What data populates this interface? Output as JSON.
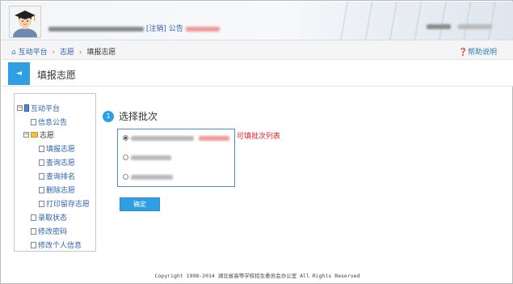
{
  "header": {
    "logout_label": "[注销]",
    "notice_label": "公告",
    "avatar_icon": "graduate-avatar-icon"
  },
  "navbar": {
    "breadcrumb": [
      "互动平台",
      "志愿",
      "填报志愿"
    ],
    "help_label": "帮助说明",
    "home_icon": "home-icon",
    "help_icon": "help-circle-icon"
  },
  "titlebar": {
    "back_label": "◄",
    "title": "填报志愿"
  },
  "sidebar": {
    "root": "互动平台",
    "items": [
      {
        "label": "信息公告",
        "level": 1,
        "type": "doc"
      },
      {
        "label": "志愿",
        "level": 1,
        "type": "folder"
      },
      {
        "label": "填报志愿",
        "level": 2,
        "type": "doc"
      },
      {
        "label": "查询志愿",
        "level": 2,
        "type": "doc"
      },
      {
        "label": "查询排名",
        "level": 2,
        "type": "doc"
      },
      {
        "label": "删除志愿",
        "level": 2,
        "type": "doc"
      },
      {
        "label": "打印留存志愿",
        "level": 2,
        "type": "doc"
      },
      {
        "label": "录取状态",
        "level": 1,
        "type": "doc"
      },
      {
        "label": "修改密码",
        "level": 1,
        "type": "doc"
      },
      {
        "label": "修改个人信息",
        "level": 1,
        "type": "doc"
      }
    ]
  },
  "content": {
    "step_number": "1",
    "step_title": "选择批次",
    "hint": "可填批次列表",
    "selected_option": 1,
    "confirm_label": "确定"
  },
  "footer": {
    "copyright": "Copyright 1998-2014 湖北省高等学校招生委员会办公室 All Rights Reserved"
  },
  "colors": {
    "accent": "#2e9fe2",
    "hint": "#e02020",
    "link": "#2a5fb0"
  }
}
